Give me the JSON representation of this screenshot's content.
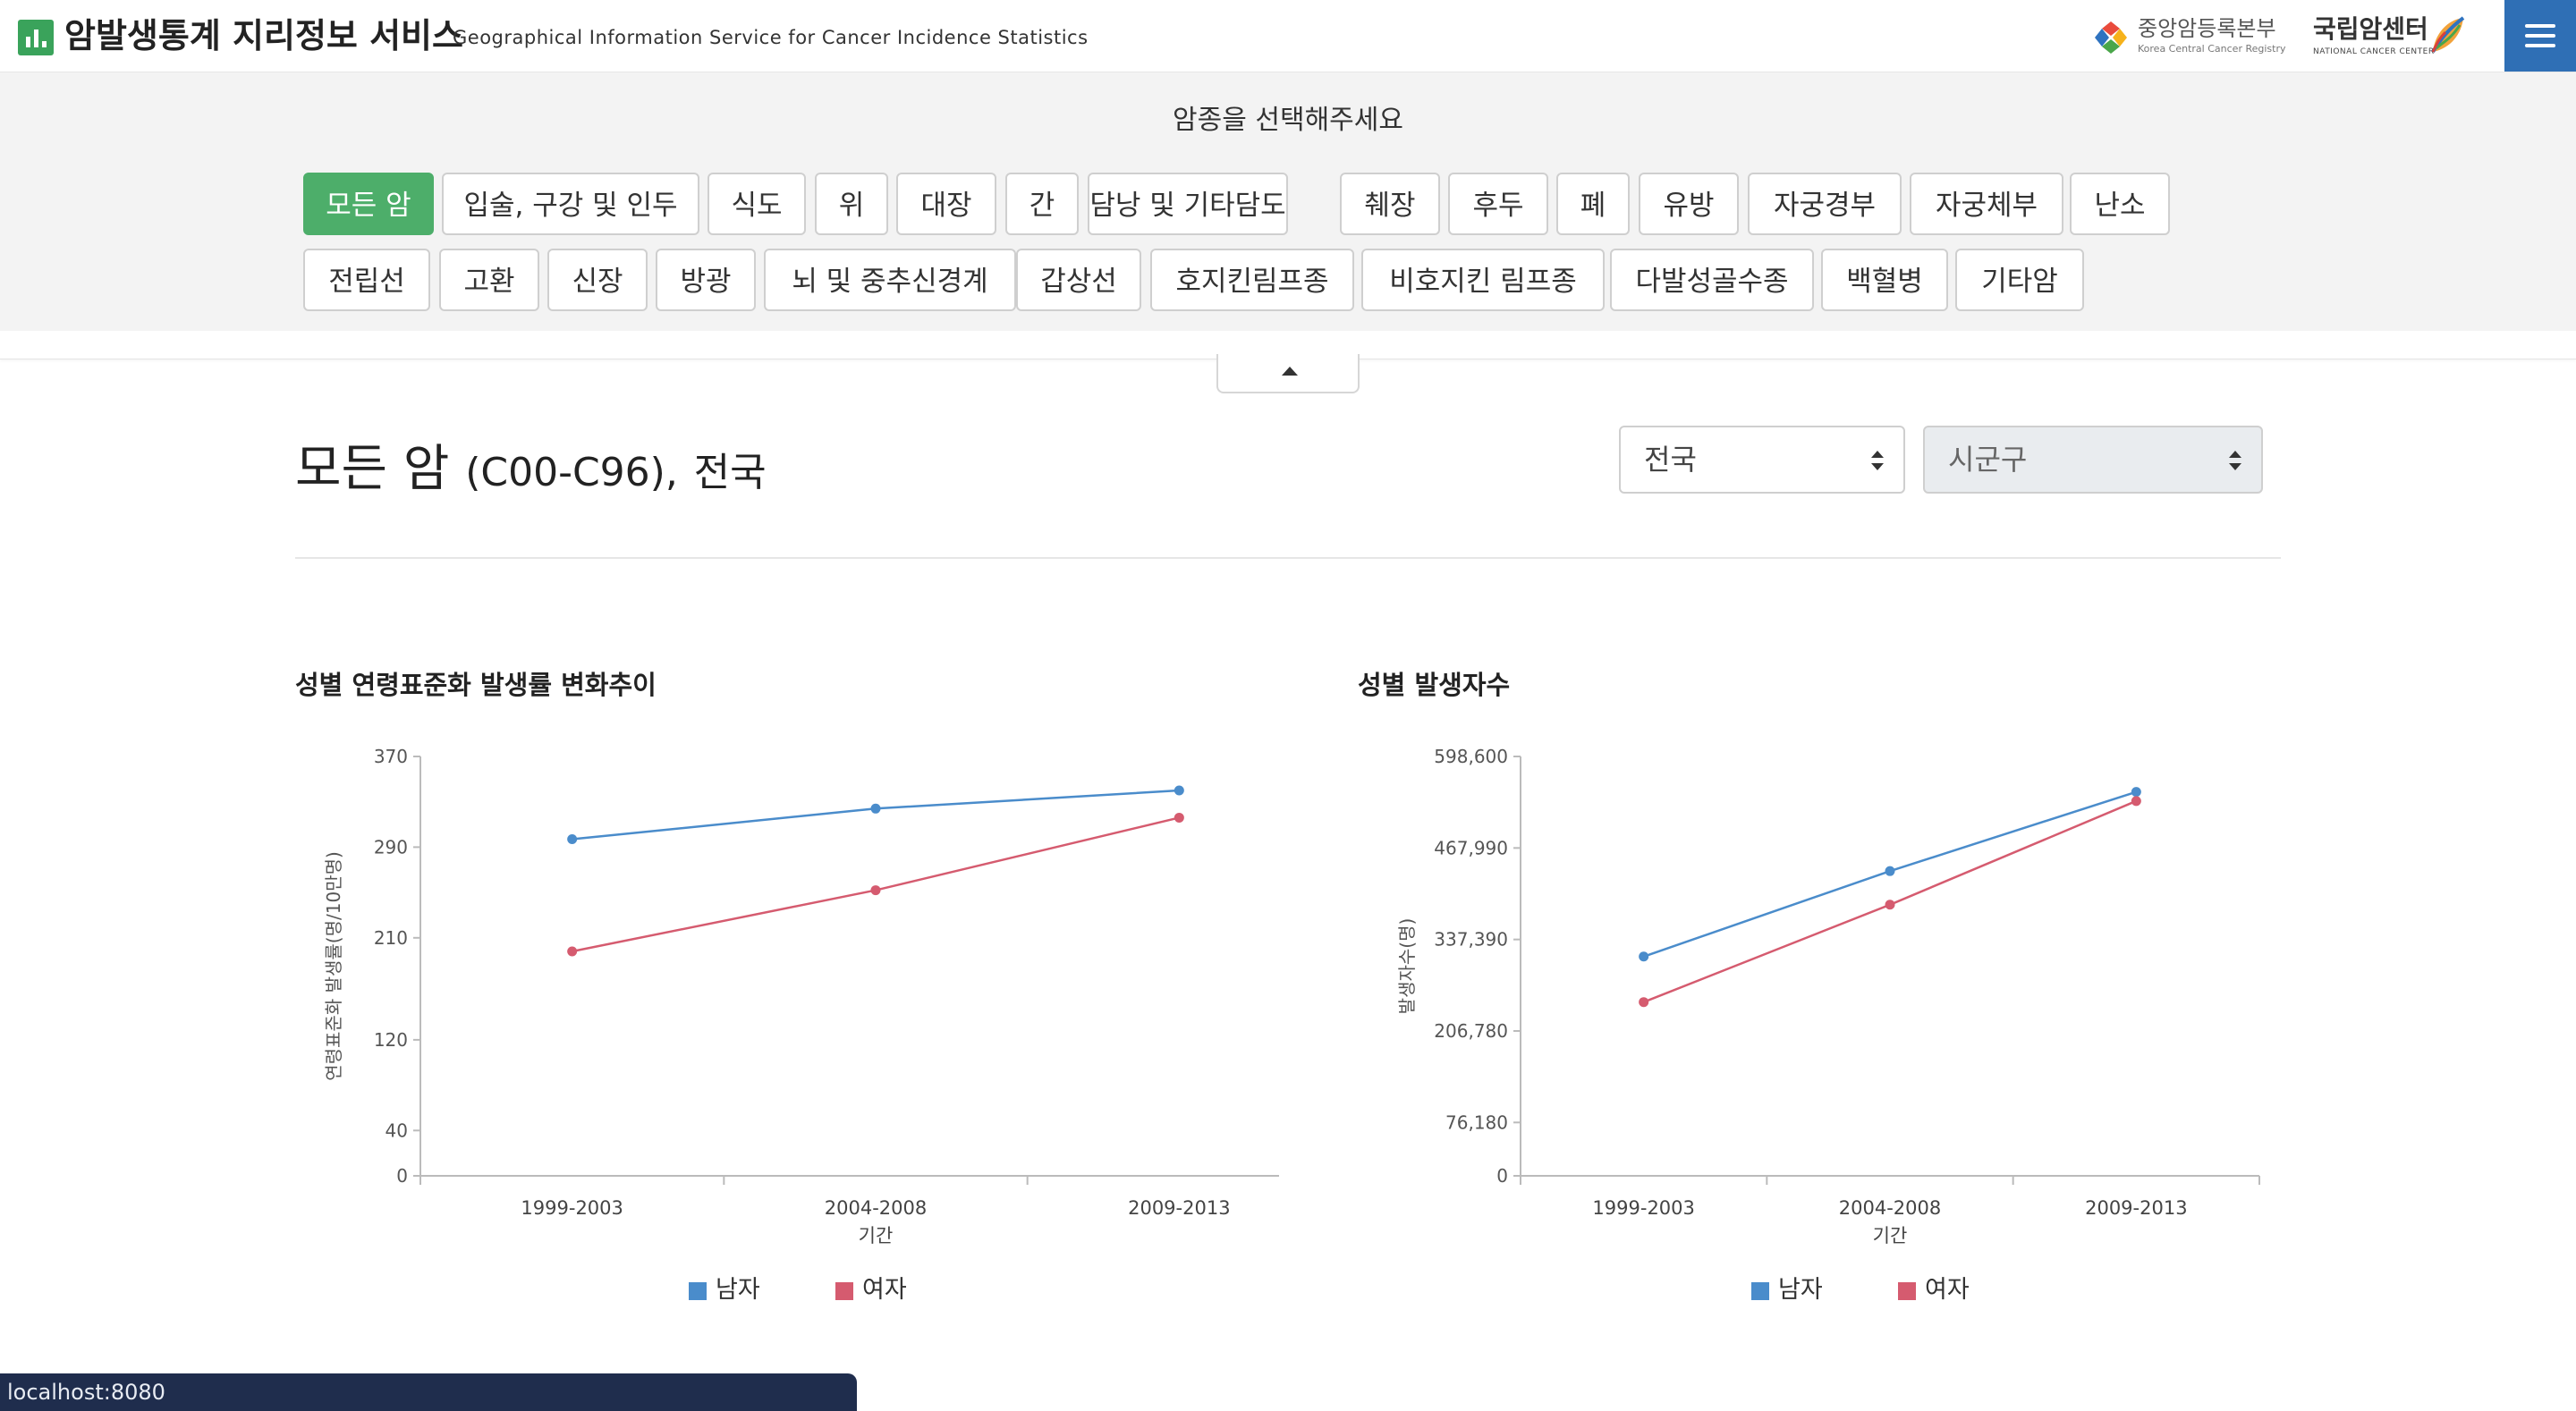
{
  "header": {
    "title": "암발생통계 지리정보 서비스",
    "subtitle": "Geographical Information Service for Cancer Incidence Statistics",
    "org1_name": "중앙암등록본부",
    "org1_en": "Korea Central Cancer Registry",
    "org2_name": "국립암센터",
    "org2_en": "NATIONAL CANCER CENTER",
    "menu_icon": "hamburger-menu-icon"
  },
  "selector": {
    "prompt": "암종을 선택해주세요",
    "active": "모든 암",
    "row1": [
      "모든 암",
      "입술, 구강 및 인두",
      "식도",
      "위",
      "대장",
      "간",
      "담낭 및 기타담도",
      "췌장",
      "후두",
      "폐",
      "유방",
      "자궁경부",
      "자궁체부",
      "난소"
    ],
    "row2": [
      "전립선",
      "고환",
      "신장",
      "방광",
      "뇌 및 중추신경계",
      "갑상선",
      "호지킨림프종",
      "비호지킨 림프종",
      "다발성골수종",
      "백혈병",
      "기타암"
    ],
    "collapse_icon": "caret-up-icon"
  },
  "main": {
    "title_name": "모든 암",
    "title_code": "(C00-C96),",
    "title_region": "전국",
    "region_select": "전국",
    "district_select": "시군구"
  },
  "colors": {
    "male": "#4a8ccb",
    "female": "#d55b6f",
    "active_button": "#4dae6a",
    "menu": "#2f6fb5"
  },
  "chart_data": [
    {
      "type": "line",
      "title": "성별 연령표준화 발생률 변화추이",
      "xlabel": "기간",
      "ylabel": "연령표준화 발생률(명/10만명)",
      "categories": [
        "1999-2003",
        "2004-2008",
        "2009-2013"
      ],
      "yticks": [
        0,
        40,
        120,
        210,
        290,
        370
      ],
      "ylim": [
        0,
        370
      ],
      "series": [
        {
          "name": "남자",
          "values": [
            297,
            324,
            340
          ]
        },
        {
          "name": "여자",
          "values": [
            198,
            252,
            316
          ]
        }
      ],
      "legend": "bottom"
    },
    {
      "type": "line",
      "title": "성별 발생자수",
      "xlabel": "기간",
      "ylabel": "발생자수(명)",
      "categories": [
        "1999-2003",
        "2004-2008",
        "2009-2013"
      ],
      "yticks": [
        0,
        76180,
        206780,
        337390,
        467990,
        598600
      ],
      "ytick_labels": [
        "0",
        "76,180",
        "206,780",
        "337,390",
        "467,990",
        "598,600"
      ],
      "ylim": [
        0,
        598600
      ],
      "series": [
        {
          "name": "남자",
          "values": [
            313000,
            435000,
            548000
          ]
        },
        {
          "name": "여자",
          "values": [
            248000,
            387000,
            535000
          ]
        }
      ],
      "legend": "bottom"
    }
  ],
  "status_bar": {
    "url": "localhost:8080"
  }
}
